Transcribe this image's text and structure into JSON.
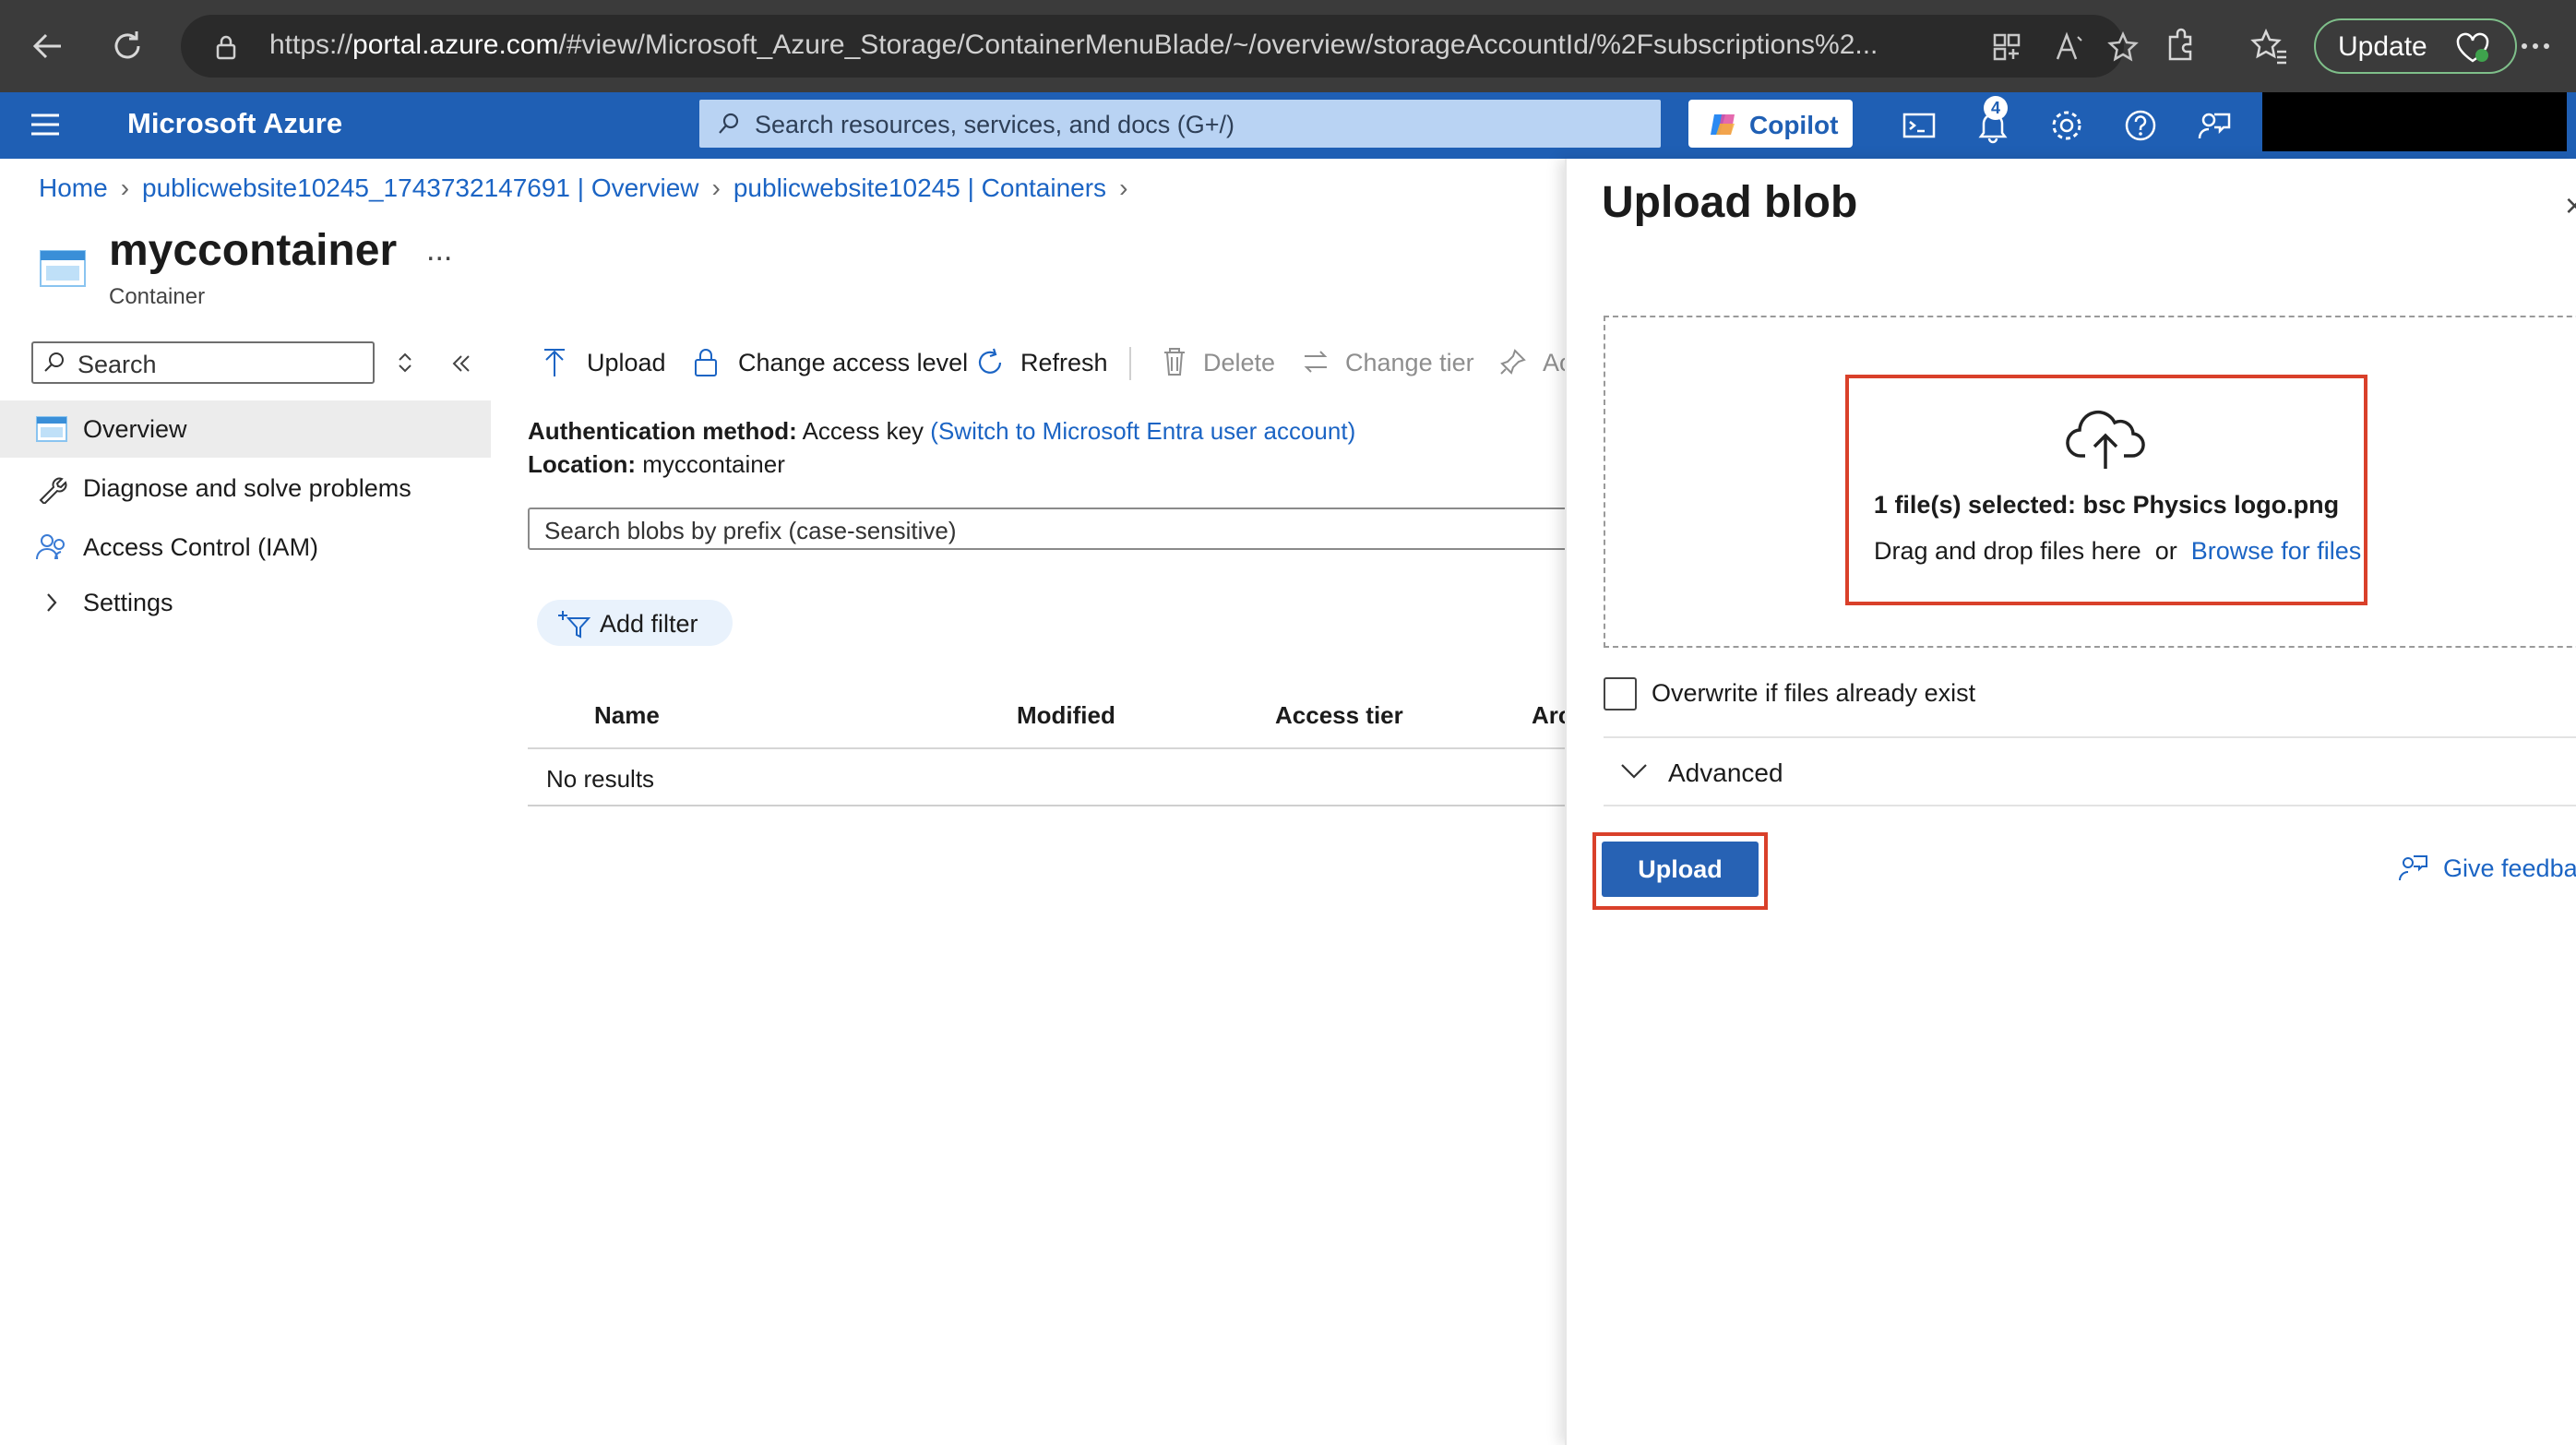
{
  "browser": {
    "url_prefix": "https://",
    "url_host": "portal.azure.com",
    "url_rest": "/#view/Microsoft_Azure_Storage/ContainerMenuBlade/~/overview/storageAccountId/%2Fsubscriptions%2...",
    "update_label": "Update"
  },
  "header": {
    "brand": "Microsoft Azure",
    "search_placeholder": "Search resources, services, and docs (G+/)",
    "copilot_label": "Copilot",
    "notification_count": "4"
  },
  "breadcrumb": {
    "items": [
      "Home",
      "publicwebsite10245_1743732147691 | Overview",
      "publicwebsite10245 | Containers"
    ]
  },
  "page": {
    "title": "myccontainer",
    "subtitle": "Container",
    "more": "..."
  },
  "sidebar": {
    "search_placeholder": "Search",
    "items": [
      {
        "label": "Overview"
      },
      {
        "label": "Diagnose and solve problems"
      },
      {
        "label": "Access Control (IAM)"
      },
      {
        "label": "Settings"
      }
    ]
  },
  "toolbar": {
    "upload": "Upload",
    "change_access": "Change access level",
    "refresh": "Refresh",
    "delete": "Delete",
    "change_tier": "Change tier",
    "acquire": "Ac"
  },
  "info": {
    "auth_label": "Authentication method:",
    "auth_value": "Access key",
    "auth_link": "(Switch to Microsoft Entra user account)",
    "location_label": "Location:",
    "location_value": "myccontainer"
  },
  "blob_search": {
    "placeholder": "Search blobs by prefix (case-sensitive)"
  },
  "filter": {
    "add_label": "Add filter"
  },
  "table": {
    "columns": [
      "Name",
      "Modified",
      "Access tier",
      "Arc"
    ],
    "empty_text": "No results"
  },
  "blade": {
    "title": "Upload blob",
    "close": "×",
    "selected_text": "1 file(s) selected: bsc Physics logo.png",
    "drag_text": "Drag and drop files here",
    "or_text": "or",
    "browse_link": "Browse for files",
    "overwrite_label": "Overwrite if files already exist",
    "advanced_label": "Advanced",
    "upload_button": "Upload",
    "feedback_label": "Give feedbac"
  },
  "colors": {
    "azure_blue": "#1f5fb4",
    "link": "#1b64c4",
    "highlight": "#d9402a",
    "primary_button": "#2762b4"
  },
  "icons": [
    "back-icon",
    "reload-icon",
    "lock-icon",
    "apps-icon",
    "read-aloud-icon",
    "favorite-icon",
    "extensions-icon",
    "favorites-icon",
    "more-icon",
    "hamburger-icon",
    "search-icon",
    "copilot-icon",
    "cloud-shell-icon",
    "bell-icon",
    "gear-icon",
    "help-icon",
    "feedback-icon",
    "container-icon",
    "wrench-icon",
    "people-icon",
    "chevron-right-icon",
    "upload-icon",
    "padlock-icon",
    "refresh-icon",
    "trash-icon",
    "swap-icon",
    "pin-icon",
    "filter-icon",
    "cloud-upload-icon",
    "chevron-down-icon"
  ]
}
